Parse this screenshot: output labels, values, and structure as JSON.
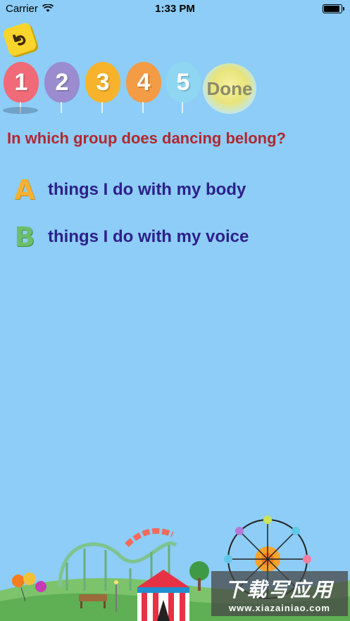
{
  "status_bar": {
    "carrier": "Carrier",
    "time": "1:33 PM"
  },
  "progress": {
    "balloons": [
      {
        "label": "1",
        "color": "#f06a78"
      },
      {
        "label": "2",
        "color": "#9a8ccf"
      },
      {
        "label": "3",
        "color": "#f7b32b"
      },
      {
        "label": "4",
        "color": "#f39b45"
      },
      {
        "label": "5",
        "color": "#8fd6f2"
      }
    ],
    "done_label": "Done"
  },
  "quiz": {
    "question": "In which group does dancing belong?",
    "answers": [
      {
        "letter": "A",
        "label": "things I do with my body",
        "color": "#f5b133"
      },
      {
        "letter": "B",
        "label": "things I do with my voice",
        "color": "#6dbd6d"
      }
    ]
  },
  "watermark": {
    "title": "下载写应用",
    "url": "www.xiazainiao.com"
  }
}
